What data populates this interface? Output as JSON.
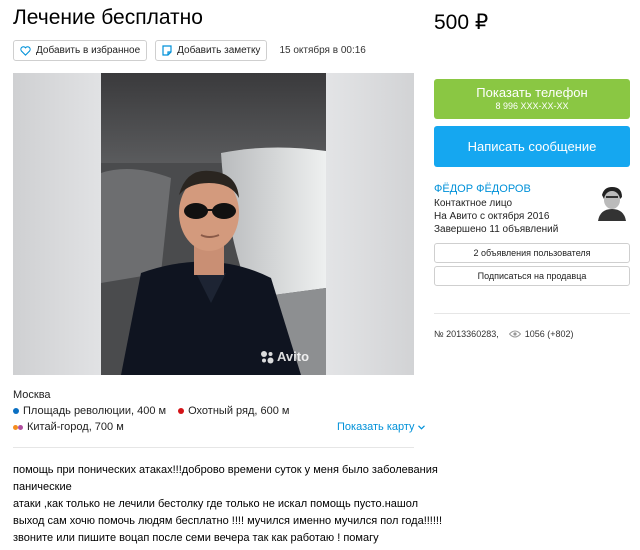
{
  "listing": {
    "title": "Лечение бесплатно",
    "price": "500 ₽"
  },
  "actions": {
    "favorite_label": "Добавить в избранное",
    "note_label": "Добавить заметку",
    "date": "15 октября в 00:16"
  },
  "gallery": {
    "watermark": "Avito"
  },
  "location": {
    "city": "Москва",
    "metro": [
      {
        "name": "Площадь революции, 400 м",
        "color": "#0a6fc2"
      },
      {
        "name": "Охотный ряд, 600 м",
        "color": "#d41317"
      },
      {
        "name": "Китай-город, 700 м",
        "color": "#f58d1f",
        "color2": "#b14e9f"
      }
    ],
    "show_map": "Показать карту"
  },
  "description": {
    "lines": [
      "помощь при понических атаках!!!доброво времени суток у меня было заболевания",
      "панические",
      "атаки ,как только не лечили бестолку где только не искал помощь пусто.нашол",
      "выход сам хочю помочь людям бесплатно !!!! мучился именно мучился пол года!!!!!!",
      "звоните или пишите воцап после семи вечера так как работаю ! помагу"
    ]
  },
  "contact": {
    "phone_label": "Показать телефон",
    "phone_masked": "8 996 XXX-XX-XX",
    "message_label": "Написать сообщение",
    "colors": {
      "phone": "#8ac743",
      "message": "#15a7f0",
      "link": "#0091d9"
    }
  },
  "seller": {
    "name": "ФЁДОР ФЁДОРОВ",
    "role": "Контактное лицо",
    "since": "На Авито с октября 2016",
    "completed": "Завершено 11 объявлений",
    "user_ads_button": "2 объявления пользователя",
    "subscribe_button": "Подписаться на продавца"
  },
  "stats": {
    "ad_number": "№ 2013360283,",
    "views": "1056 (+802)"
  }
}
